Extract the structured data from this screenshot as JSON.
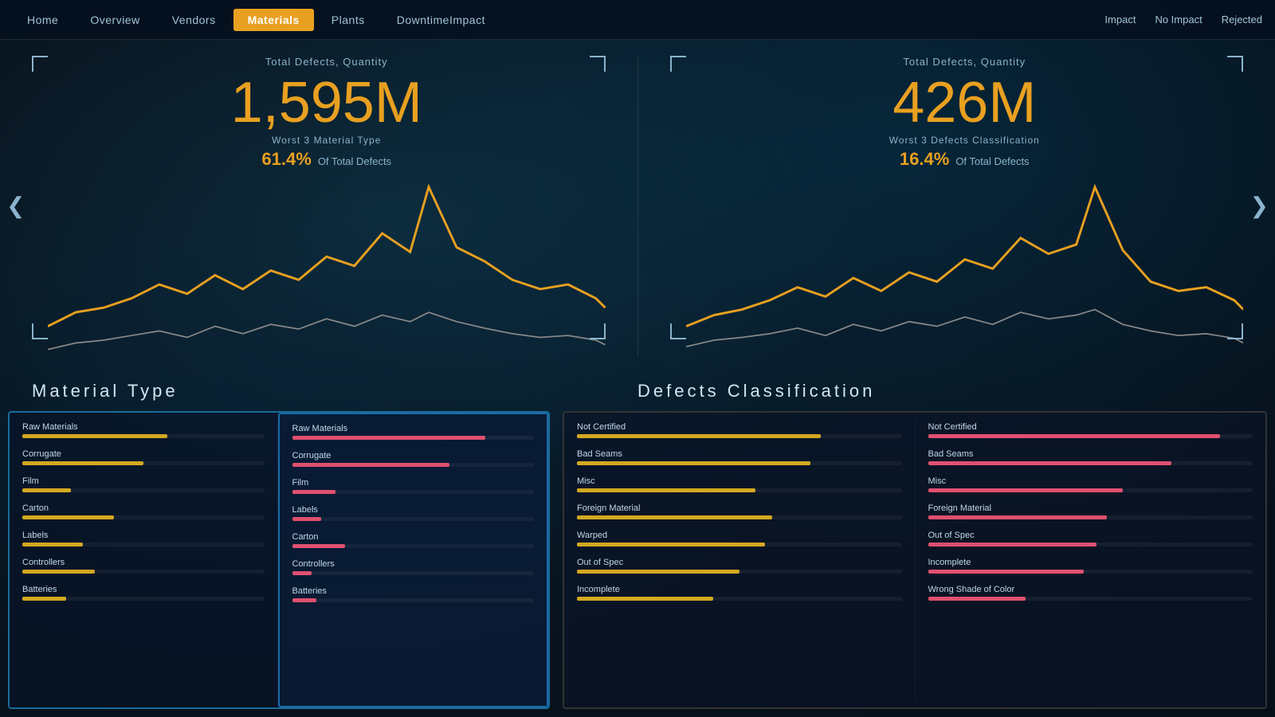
{
  "topbar": {
    "nav": [
      {
        "label": "Home",
        "active": false
      },
      {
        "label": "Overview",
        "active": false
      },
      {
        "label": "Vendors",
        "active": false
      },
      {
        "label": "Materials",
        "active": true
      },
      {
        "label": "Plants",
        "active": false
      },
      {
        "label": "DowntimeImpact",
        "active": false
      }
    ],
    "filters": [
      {
        "label": "Impact",
        "active": false
      },
      {
        "label": "No Impact",
        "active": false
      },
      {
        "label": "Rejected",
        "active": false
      }
    ]
  },
  "left_chart": {
    "title": "Total Defects, Quantity",
    "big_number": "1,595M",
    "sub_label": "Worst 3 Material Type",
    "pct": "61.4%",
    "pct_text": "Of Total Defects"
  },
  "right_chart": {
    "title": "Total Defects, Quantity",
    "big_number": "426M",
    "sub_label": "Worst 3 Defects Classification",
    "pct": "16.4%",
    "pct_text": "Of Total Defects"
  },
  "section_titles": {
    "left": "Material Type",
    "right": "Defects Classification"
  },
  "left_panel_col1": {
    "items": [
      {
        "label": "Raw Materials",
        "yellow": 60,
        "pink": 0
      },
      {
        "label": "Corrugate",
        "yellow": 50,
        "pink": 0
      },
      {
        "label": "Film",
        "yellow": 20,
        "pink": 0
      },
      {
        "label": "Carton",
        "yellow": 38,
        "pink": 0
      },
      {
        "label": "Labels",
        "yellow": 25,
        "pink": 0
      },
      {
        "label": "Controllers",
        "yellow": 30,
        "pink": 0
      },
      {
        "label": "Batteries",
        "yellow": 18,
        "pink": 0
      }
    ]
  },
  "left_panel_col2": {
    "items": [
      {
        "label": "Raw Materials",
        "yellow": 0,
        "pink": 80
      },
      {
        "label": "Corrugate",
        "yellow": 0,
        "pink": 65
      },
      {
        "label": "Film",
        "yellow": 0,
        "pink": 18
      },
      {
        "label": "Labels",
        "yellow": 0,
        "pink": 12
      },
      {
        "label": "Carton",
        "yellow": 0,
        "pink": 22
      },
      {
        "label": "Controllers",
        "yellow": 0,
        "pink": 8
      },
      {
        "label": "Batteries",
        "yellow": 0,
        "pink": 10
      }
    ]
  },
  "right_panel_col1": {
    "items": [
      {
        "label": "Not Certified",
        "yellow": 75,
        "pink": 0
      },
      {
        "label": "Bad Seams",
        "yellow": 72,
        "pink": 0
      },
      {
        "label": "Misc",
        "yellow": 55,
        "pink": 0
      },
      {
        "label": "Foreign Material",
        "yellow": 60,
        "pink": 0
      },
      {
        "label": "Warped",
        "yellow": 58,
        "pink": 0
      },
      {
        "label": "Out of Spec",
        "yellow": 50,
        "pink": 0
      },
      {
        "label": "Incomplete",
        "yellow": 42,
        "pink": 0
      }
    ]
  },
  "right_panel_col2": {
    "items": [
      {
        "label": "Not Certified",
        "yellow": 0,
        "pink": 90
      },
      {
        "label": "Bad Seams",
        "yellow": 0,
        "pink": 75
      },
      {
        "label": "Misc",
        "yellow": 0,
        "pink": 60
      },
      {
        "label": "Foreign Material",
        "yellow": 0,
        "pink": 55
      },
      {
        "label": "Out of Spec",
        "yellow": 0,
        "pink": 52
      },
      {
        "label": "Incomplete",
        "yellow": 0,
        "pink": 48
      },
      {
        "label": "Wrong Shade of Color",
        "yellow": 0,
        "pink": 30
      }
    ]
  },
  "arrows": {
    "left": "❮",
    "right": "❯"
  }
}
